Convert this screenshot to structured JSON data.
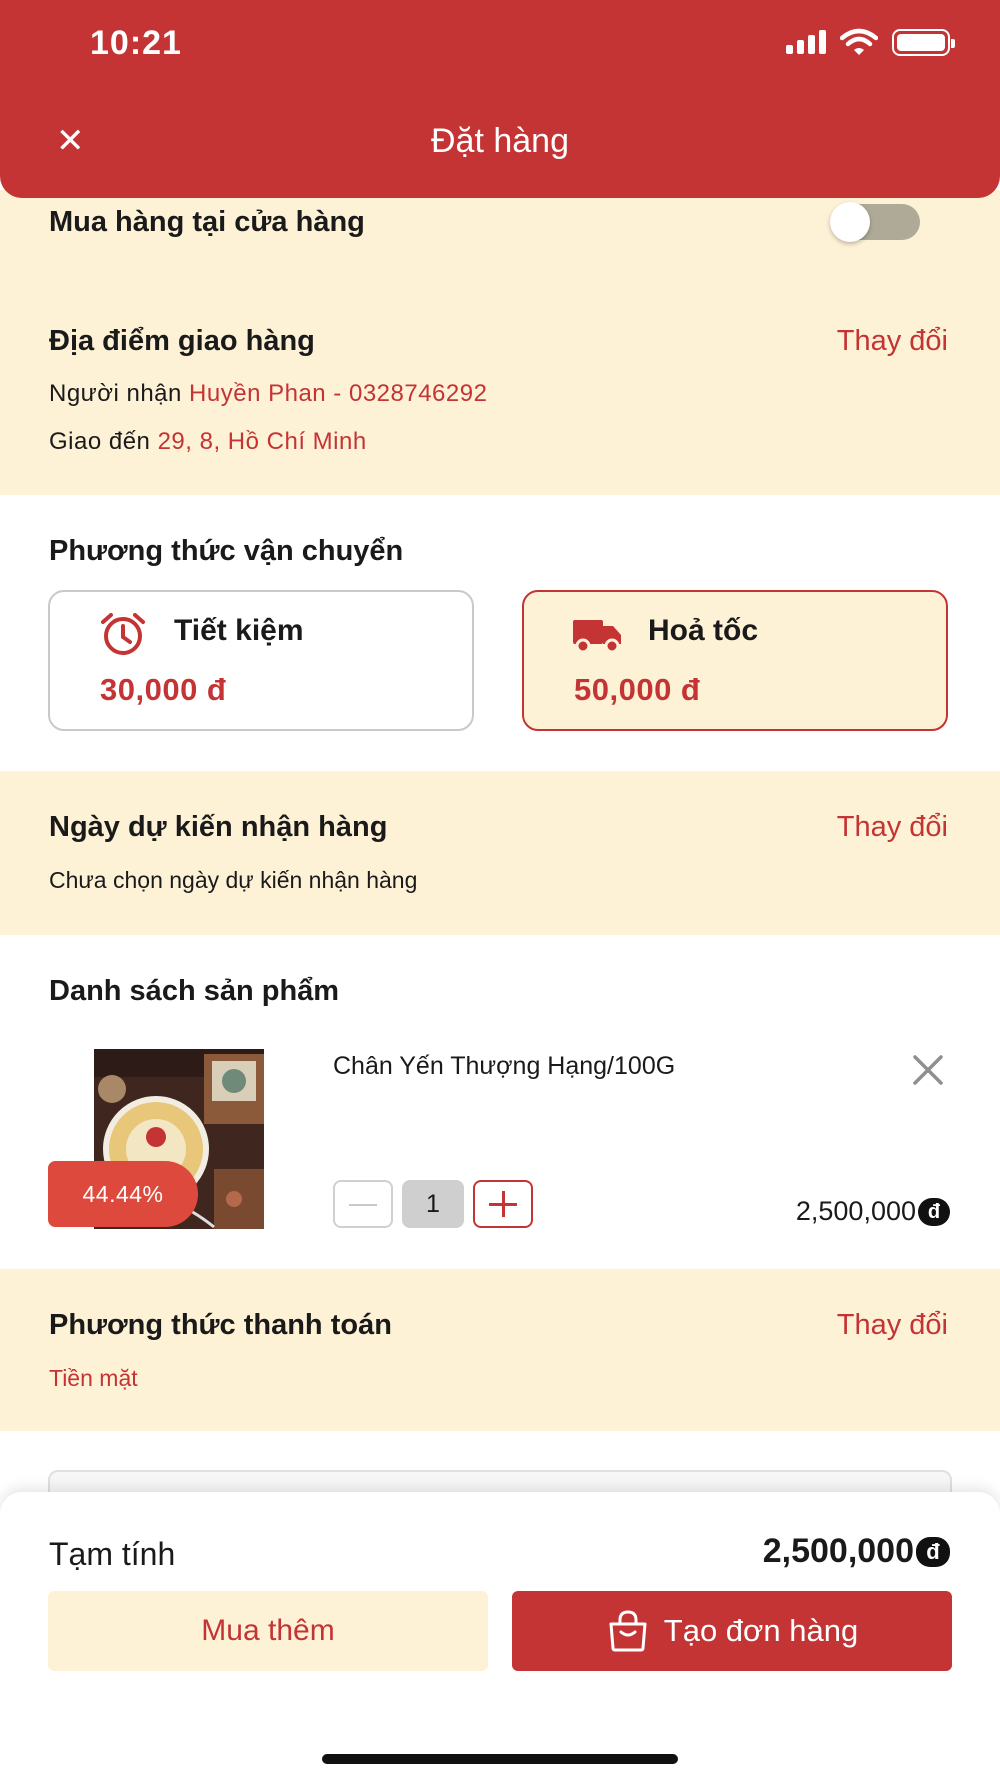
{
  "status_bar": {
    "time": "10:21"
  },
  "header": {
    "title": "Đặt hàng",
    "close_icon": "close-icon"
  },
  "store_purchase": {
    "label": "Mua hàng tại cửa hàng",
    "enabled": false
  },
  "delivery": {
    "title": "Địa điểm giao hàng",
    "change_label": "Thay đổi",
    "recipient_prefix": "Người nhận",
    "recipient": "Huyền Phan - 0328746292",
    "address_prefix": "Giao đến",
    "address": "29, 8, Hồ Chí Minh"
  },
  "shipping": {
    "title": "Phương thức vận chuyển",
    "options": [
      {
        "name": "Tiết kiệm",
        "price": "30,000 đ",
        "icon": "alarm-clock-icon",
        "selected": false
      },
      {
        "name": "Hoả tốc",
        "price": "50,000 đ",
        "icon": "truck-icon",
        "selected": true
      }
    ]
  },
  "delivery_date": {
    "title": "Ngày dự kiến nhận hàng",
    "change_label": "Thay đổi",
    "value": "Chưa chọn ngày dự kiến nhận hàng"
  },
  "products": {
    "title": "Danh sách sản phẩm",
    "items": [
      {
        "name": "Chân Yến Thượng Hạng/100G",
        "discount": "44.44%",
        "quantity": "1",
        "price": "2,500,000",
        "currency": "đ"
      }
    ]
  },
  "payment": {
    "title": "Phương thức thanh toán",
    "change_label": "Thay đổi",
    "method": "Tiền mặt"
  },
  "footer": {
    "subtotal_label": "Tạm tính",
    "subtotal_value": "2,500,000",
    "currency": "đ",
    "buy_more_label": "Mua thêm",
    "create_order_label": "Tạo đơn hàng"
  },
  "colors": {
    "primary": "#c43434",
    "cream": "#fdf1d6",
    "discount": "#dd4a3d"
  }
}
